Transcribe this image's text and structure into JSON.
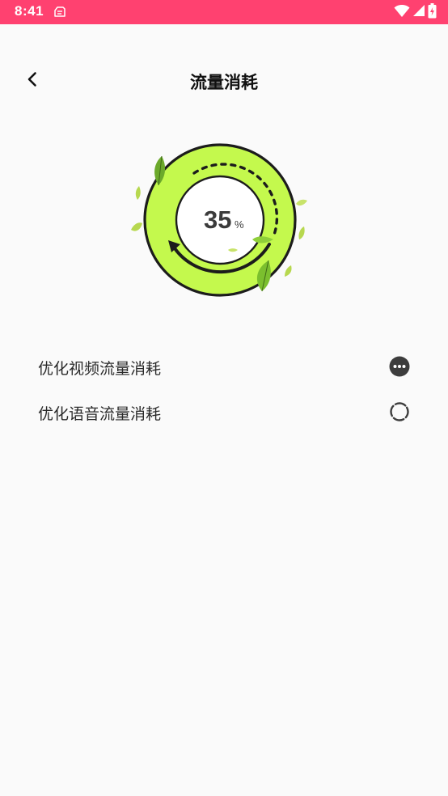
{
  "status_bar": {
    "time": "8:41",
    "background": "#ff4170",
    "icons": [
      "clipboard-notification-icon",
      "wifi-icon",
      "signal-icon",
      "battery-charging-icon"
    ]
  },
  "header": {
    "title": "流量消耗",
    "back_icon": "chevron-left-icon"
  },
  "gauge": {
    "value": "35",
    "unit": "%",
    "ring_color": "#c4f94d",
    "outline_color": "#1c1c1c",
    "progress_fraction": 0.35
  },
  "options": [
    {
      "label": "优化视频流量消耗",
      "state_icon": "more-dots-icon"
    },
    {
      "label": "优化语音流量消耗",
      "state_icon": "loading-spinner-icon"
    }
  ]
}
